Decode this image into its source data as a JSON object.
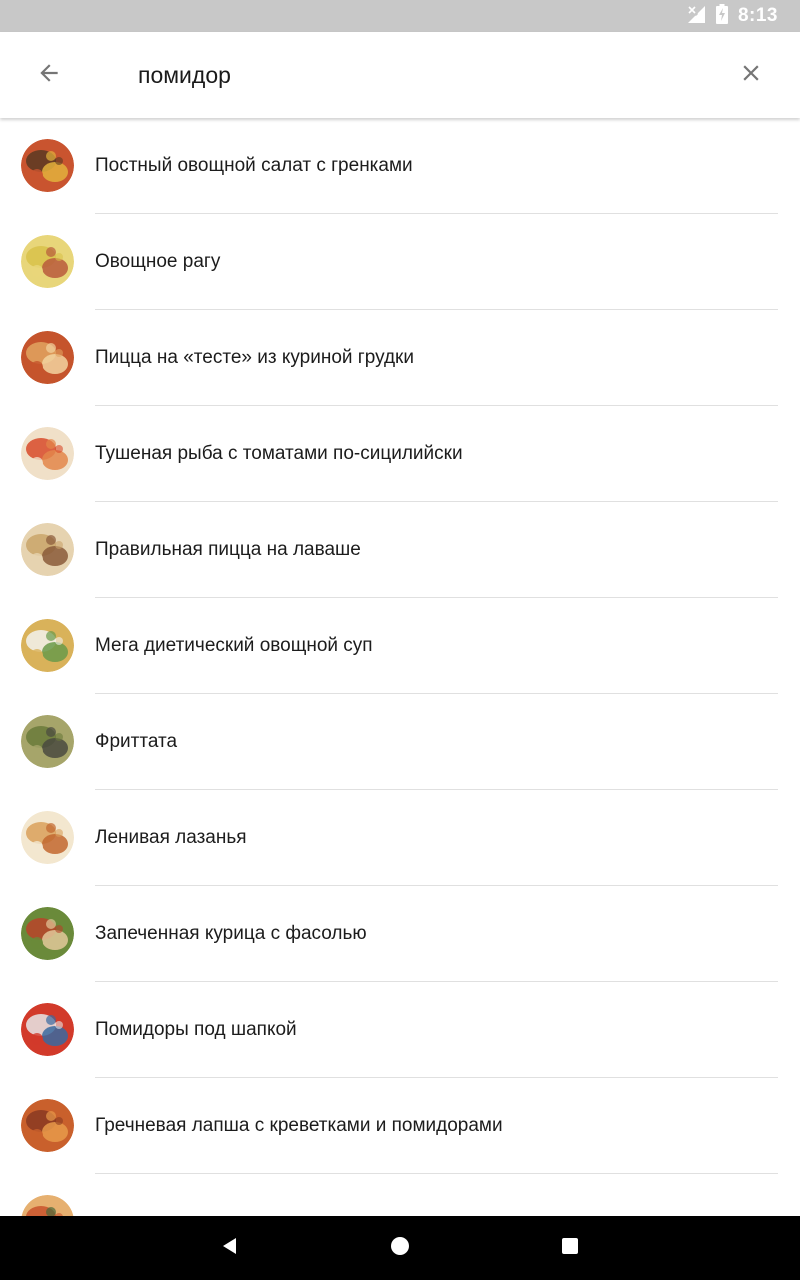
{
  "status_bar": {
    "time": "8:13",
    "icons": [
      "no-signal-icon",
      "battery-charging-icon"
    ]
  },
  "search": {
    "query": "помидор",
    "back_icon": "arrow-back-icon",
    "clear_icon": "close-icon"
  },
  "results": [
    {
      "title": "Постный овощной салат с гренками",
      "thumb_colors": [
        "#5a3a22",
        "#c9542f",
        "#e3b23c"
      ]
    },
    {
      "title": "Овощное рагу",
      "thumb_colors": [
        "#d8c24a",
        "#e8d67a",
        "#b85a3c"
      ]
    },
    {
      "title": "Пицца на «тесте» из куриной грудки",
      "thumb_colors": [
        "#e0a460",
        "#c5542c",
        "#f2d3a0"
      ]
    },
    {
      "title": "Тушеная рыба с томатами по-сицилийски",
      "thumb_colors": [
        "#d84a2a",
        "#f0e0c8",
        "#e3864a"
      ]
    },
    {
      "title": "Правильная пицца на лаваше",
      "thumb_colors": [
        "#c9a46a",
        "#e6d3b0",
        "#8a5a3a"
      ]
    },
    {
      "title": "Мега диетический овощной суп",
      "thumb_colors": [
        "#f2f2ee",
        "#d9b25a",
        "#6a9a4a"
      ]
    },
    {
      "title": "Фриттата",
      "thumb_colors": [
        "#6a7a3a",
        "#a6a56a",
        "#4a4a40"
      ]
    },
    {
      "title": "Ленивая лазанья",
      "thumb_colors": [
        "#d9a05a",
        "#f3e7cf",
        "#c2672f"
      ]
    },
    {
      "title": "Запеченная курица с фасолью",
      "thumb_colors": [
        "#b8432a",
        "#6a8a3a",
        "#e2c89a"
      ]
    },
    {
      "title": "Помидоры под шапкой",
      "thumb_colors": [
        "#e8e8e8",
        "#d23a2a",
        "#3a6aa0"
      ]
    },
    {
      "title": "Гречневая лапша с креветками и помидорами",
      "thumb_colors": [
        "#8a3a22",
        "#c9602c",
        "#e89a4a"
      ]
    },
    {
      "title": "",
      "thumb_colors": [
        "#c8542c",
        "#e6b070",
        "#4a6a3a"
      ]
    }
  ],
  "nav_bar": {
    "back_icon": "nav-back-icon",
    "home_icon": "nav-home-icon",
    "recents_icon": "nav-recents-icon"
  }
}
